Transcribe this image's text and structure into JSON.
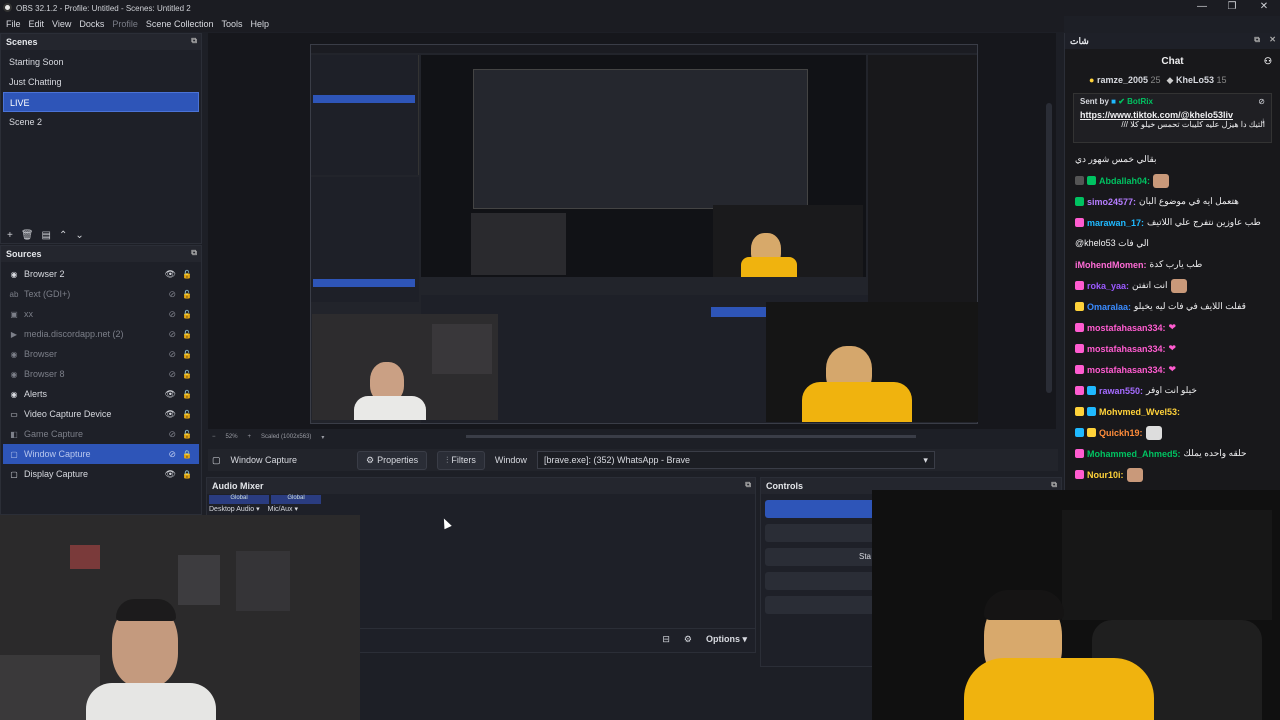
{
  "window": {
    "title": "OBS 32.1.2 - Profile: Untitled - Scenes: Untitled 2",
    "min": "—",
    "max": "❐",
    "close": "✕"
  },
  "menu": [
    "File",
    "Edit",
    "View",
    "Docks",
    "Profile",
    "Scene Collection",
    "Tools",
    "Help"
  ],
  "scenes": {
    "title": "Scenes",
    "items": [
      "Starting Soon",
      "Just Chatting",
      "LIVE",
      "Scene 2"
    ],
    "selected": 2
  },
  "sources": {
    "title": "Sources",
    "items": [
      {
        "name": "Browser 2",
        "visible": true
      },
      {
        "name": "Text (GDI+)",
        "visible": false
      },
      {
        "name": "xx",
        "visible": false
      },
      {
        "name": "media.discordapp.net (2)",
        "visible": false
      },
      {
        "name": "Browser",
        "visible": false
      },
      {
        "name": "Browser 8",
        "visible": false
      },
      {
        "name": "Alerts",
        "visible": true
      },
      {
        "name": "Video Capture Device",
        "visible": true
      },
      {
        "name": "Game Capture",
        "visible": false
      },
      {
        "name": "Window Capture",
        "visible": false,
        "selected": true
      },
      {
        "name": "Display Capture",
        "visible": true
      }
    ]
  },
  "preview": {
    "zoom": "52%",
    "scaled": "Scaled (1002x563)"
  },
  "source_bar": {
    "source": "Window Capture",
    "properties": "Properties",
    "filters": "Filters",
    "window_label": "Window",
    "window_value": "[brave.exe]: (352) WhatsApp - Brave"
  },
  "mixer": {
    "title": "Audio Mixer",
    "tracks": [
      {
        "global": "Global",
        "name": "Desktop Audio"
      },
      {
        "global": "Global",
        "name": "Mic/Aux"
      }
    ],
    "options": "Options"
  },
  "controls": {
    "title": "Controls",
    "start_partial": "Sta"
  },
  "chat": {
    "dock_title": "شات",
    "title": "Chat",
    "pinned": [
      {
        "user": "ramze_2005",
        "count": "25"
      },
      {
        "user": "KheLo53",
        "count": "15"
      }
    ],
    "highlight": {
      "sent_by": "Sent by",
      "bot": "BotRix",
      "link": "https://www.tiktok.com/@khelo53liv",
      "text": "التيك دا هيزل عليه كليبات تحمس خيلو كلا ///"
    },
    "messages": [
      {
        "user": "",
        "text": "بقالي خمس شهور دي",
        "color": "#efeff1"
      },
      {
        "user": "Abdallah04:",
        "text": "",
        "color": "#00c261"
      },
      {
        "user": "simo24577:",
        "text": "هتعمل ايه في موضوع البان",
        "color": "#b57dff"
      },
      {
        "user": "marawan_17:",
        "text": "طب عاوزين نتفرج علي اللاتيف",
        "color": "#1fb9ff"
      },
      {
        "user": "",
        "text": "@khelo53 الي فات",
        "color": "#efeff1"
      },
      {
        "user": "iMohendMomen:",
        "text": "طب يارب كدة",
        "color": "#ff6bd6"
      },
      {
        "user": "roka_yaa:",
        "text": "انت اتفتن",
        "color": "#9b59ff"
      },
      {
        "user": "Omaralaa:",
        "text": "قفلت اللايف في فات ليه يخيلو",
        "color": "#3a8bff"
      },
      {
        "user": "mostafahasan334:",
        "text": "",
        "color": "#ff5cd0"
      },
      {
        "user": "mostafahasan334:",
        "text": "",
        "color": "#ff5cd0"
      },
      {
        "user": "mostafahasan334:",
        "text": "",
        "color": "#ff5cd0"
      },
      {
        "user": "rawan550:",
        "text": "خيلو انت اوفر",
        "color": "#a46bff"
      },
      {
        "user": "Mohvmed_Wvel53:",
        "text": "",
        "color": "#ffd23a"
      },
      {
        "user": "Quickh19:",
        "text": "",
        "color": "#ff8c3a"
      },
      {
        "user": "Mohammed_Ahmed5:",
        "text": "حلقه واحده يملك",
        "color": "#00c261"
      },
      {
        "user": "Nour10i:",
        "text": "",
        "color": "#ffd23a"
      }
    ]
  },
  "colors": {
    "accent": "#2e55b8",
    "panel": "#1e2028",
    "chat_bg": "#18181b"
  }
}
